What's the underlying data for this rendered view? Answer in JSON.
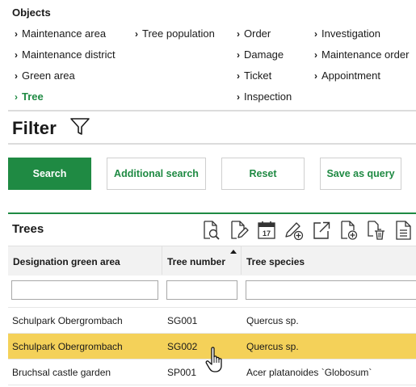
{
  "objects": {
    "title": "Objects",
    "items": [
      {
        "label": "Maintenance area"
      },
      {
        "label": "Tree population"
      },
      {
        "label": "Order"
      },
      {
        "label": "Investigation"
      },
      {
        "label": "Maintenance district"
      },
      {
        "label": "Damage"
      },
      {
        "label": "Maintenance order"
      },
      {
        "label": "Green area"
      },
      {
        "label": "Ticket"
      },
      {
        "label": "Appointment"
      },
      {
        "label": "Tree"
      },
      {
        "label": "Inspection"
      }
    ],
    "active_item": "Tree",
    "chevron": "›"
  },
  "filter": {
    "title": "Filter",
    "icon": "funnel-icon",
    "buttons": {
      "search": "Search",
      "additional_search": "Additional search",
      "reset": "Reset",
      "save_as_query": "Save as query"
    }
  },
  "trees": {
    "title": "Trees",
    "toolbar_icons": [
      "view-document-icon",
      "edit-document-icon",
      "calendar-icon",
      "pencil-add-icon",
      "open-external-icon",
      "add-document-icon",
      "copy-delete-icon",
      "document-icon"
    ],
    "calendar_day": "17",
    "columns": [
      {
        "label": "Designation green area"
      },
      {
        "label": "Tree number",
        "sorted": "ascending"
      },
      {
        "label": "Tree species"
      }
    ],
    "filters": [
      "",
      "",
      ""
    ],
    "rows": [
      {
        "area": "Schulpark Obergrombach",
        "number": "SG001",
        "species": "Quercus sp.",
        "selected": false
      },
      {
        "area": "Schulpark Obergrombach",
        "number": "SG002",
        "species": "Quercus sp.",
        "selected": true
      },
      {
        "area": "Bruchsal castle garden",
        "number": "SP001",
        "species": "Acer platanoides `Globosum`",
        "selected": false
      }
    ]
  },
  "colors": {
    "accent": "#1f8a43",
    "selected_row": "#f4d159",
    "header_bg": "#f2f2f2"
  },
  "cursor": "hand-pointer-icon"
}
